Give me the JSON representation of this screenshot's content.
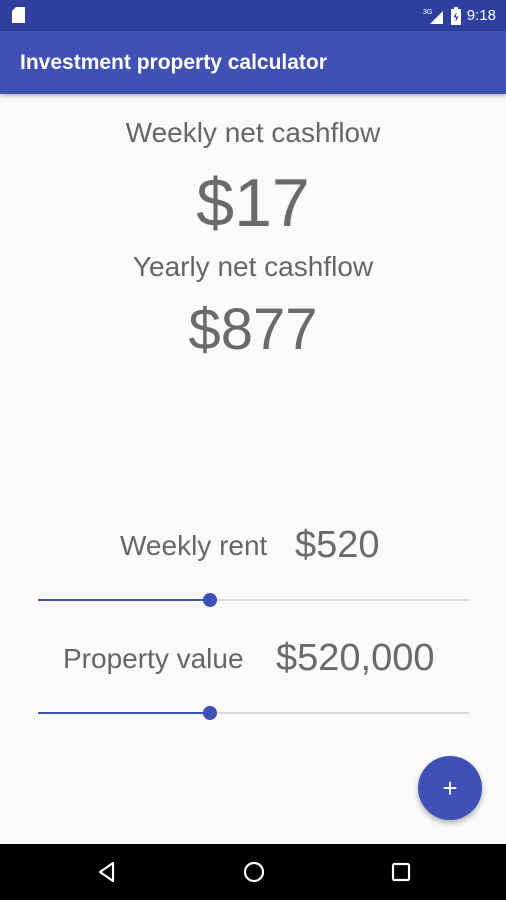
{
  "status_bar": {
    "time": "9:18",
    "network": "3G",
    "icons": [
      "sd-card-icon",
      "signal-icon",
      "battery-icon"
    ]
  },
  "app_bar": {
    "title": "Investment property calculator"
  },
  "summary": {
    "weekly_label": "Weekly net cashflow",
    "weekly_value": "$17",
    "yearly_label": "Yearly net cashflow",
    "yearly_value": "$877"
  },
  "weekly_rent": {
    "label": "Weekly rent",
    "value": "$520",
    "slider_fraction": 0.4
  },
  "property_value": {
    "label": "Property value",
    "value": "$520,000",
    "slider_fraction": 0.4
  },
  "fab": {
    "label": "+"
  },
  "nav": {
    "icons": [
      "back-icon",
      "home-icon",
      "recents-icon"
    ]
  },
  "colors": {
    "primary": "#3f51b5",
    "primary_dark": "#2f3f9f",
    "text": "#666666",
    "background": "#fafafa"
  }
}
